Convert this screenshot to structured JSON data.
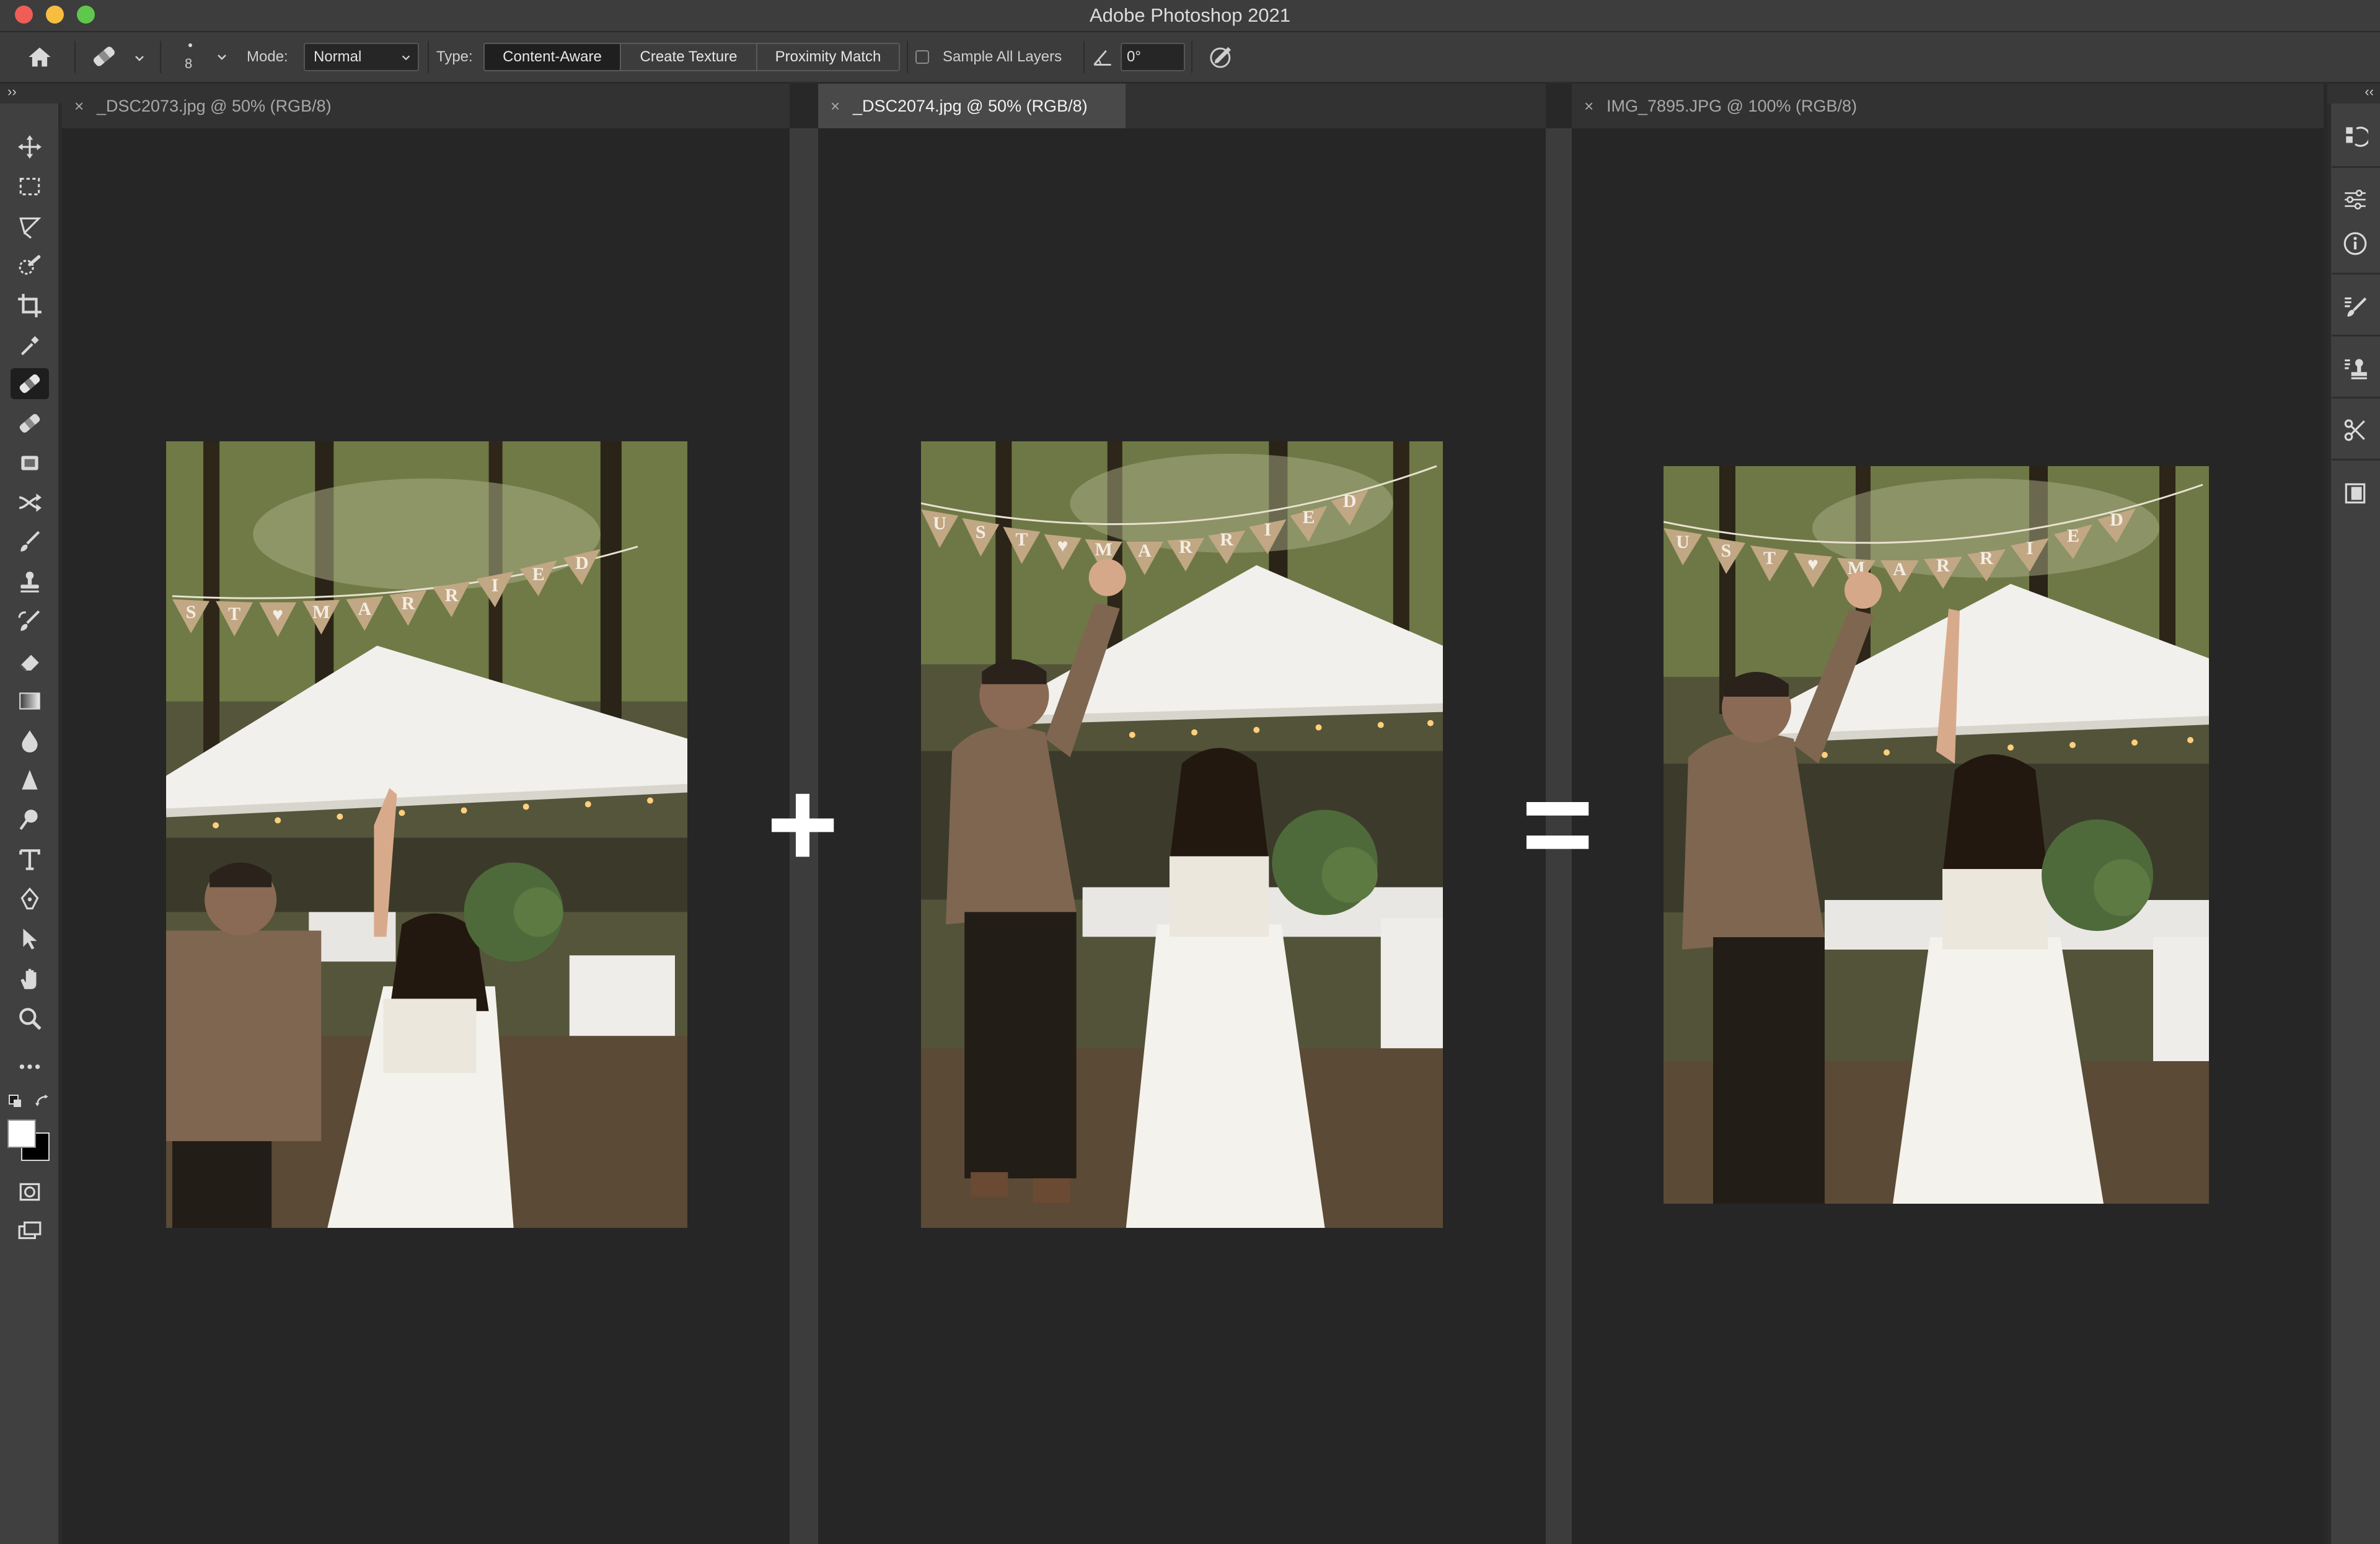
{
  "window": {
    "title": "Adobe Photoshop 2021",
    "traffic_lights": [
      "#ee5e56",
      "#f6bd3f",
      "#5fc84c"
    ]
  },
  "options_bar": {
    "brush_size": "8",
    "mode_label": "Mode:",
    "mode_value": "Normal",
    "type_label": "Type:",
    "type_options": [
      "Content-Aware",
      "Create Texture",
      "Proximity Match"
    ],
    "type_selected": "Content-Aware",
    "sample_all_layers_label": "Sample All Layers",
    "sample_all_layers_checked": false,
    "angle_value": "0°"
  },
  "tabs": [
    {
      "label": "_DSC2073.jpg @ 50% (RGB/8)",
      "active": false
    },
    {
      "label": "_DSC2074.jpg @ 50% (RGB/8)",
      "active": true
    },
    {
      "label": "IMG_7895.JPG @ 100% (RGB/8)",
      "active": false
    }
  ],
  "tab_close_glyph": "×",
  "tools": [
    "move-tool-icon",
    "marquee-tool-icon",
    "lasso-tool-icon",
    "quick-selection-tool-icon",
    "crop-tool-icon",
    "eyedropper-tool-icon",
    "spot-healing-brush-tool-icon",
    "healing-brush-tool-icon",
    "patch-tool-icon",
    "content-aware-move-tool-icon",
    "brush-tool-icon",
    "clone-stamp-tool-icon",
    "history-brush-tool-icon",
    "eraser-tool-icon",
    "gradient-tool-icon",
    "blur-tool-icon",
    "sharpen-tool-icon",
    "dodge-tool-icon",
    "type-tool-icon",
    "pen-tool-icon",
    "path-selection-tool-icon",
    "hand-tool-icon",
    "zoom-tool-icon",
    "more-tools-icon"
  ],
  "active_tool": "spot-healing-brush-tool-icon",
  "operators": {
    "plus": "+",
    "equals": "="
  },
  "banner_letters_photo1": [
    "S",
    "T",
    "♥",
    "M",
    "A",
    "R",
    "R",
    "I",
    "E",
    "D"
  ],
  "banner_letters_photo2": [
    "U",
    "S",
    "T",
    "♥",
    "M",
    "A",
    "R",
    "R",
    "I",
    "E",
    "D"
  ],
  "right_panel_icons": [
    "history-panel-icon",
    "adjustments-panel-icon",
    "info-panel-icon",
    "brush-settings-panel-icon",
    "clone-source-panel-icon",
    "tool-presets-panel-icon",
    "properties-panel-icon"
  ],
  "colors": {
    "foreground": "#ffffff",
    "background": "#000000",
    "accent_active_tab": "#494949"
  }
}
